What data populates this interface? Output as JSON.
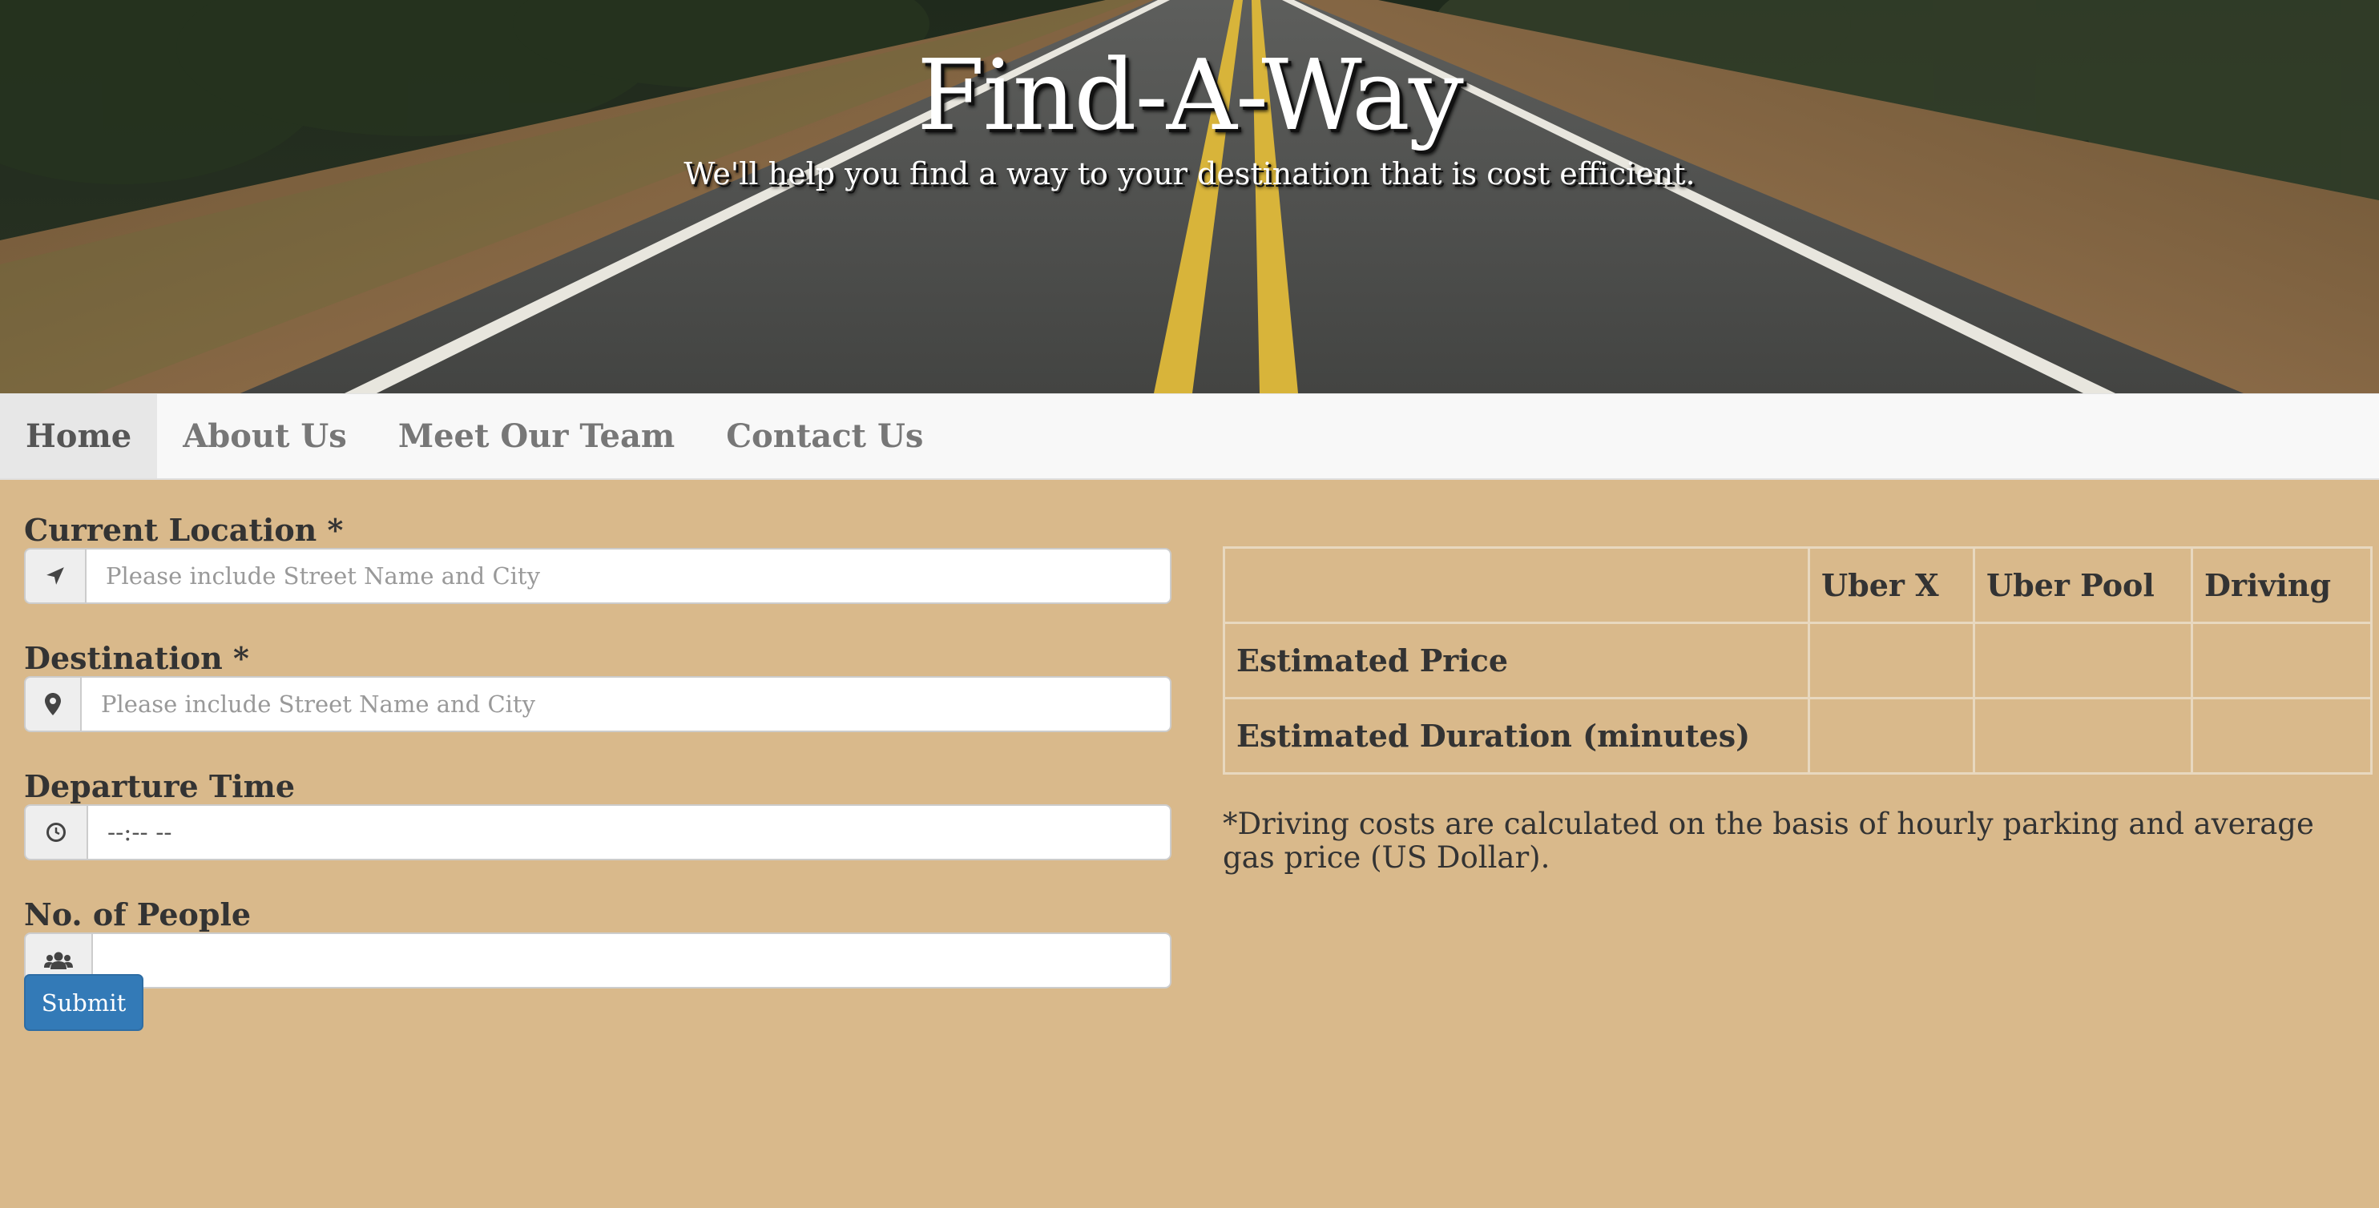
{
  "hero": {
    "title": "Find-A-Way",
    "subtitle": "We'll help you find a way to your destination that is cost efficient."
  },
  "nav": {
    "items": [
      {
        "label": "Home",
        "active": true
      },
      {
        "label": "About Us",
        "active": false
      },
      {
        "label": "Meet Our Team",
        "active": false
      },
      {
        "label": "Contact Us",
        "active": false
      }
    ]
  },
  "form": {
    "current_location": {
      "label": "Current Location *",
      "placeholder": "Please include Street Name and City",
      "value": "",
      "icon": "location-arrow-icon"
    },
    "destination": {
      "label": "Destination *",
      "placeholder": "Please include Street Name and City",
      "value": "",
      "icon": "map-marker-icon"
    },
    "departure_time": {
      "label": "Departure Time",
      "display": "--:-- --",
      "icon": "clock-icon"
    },
    "people": {
      "label": "No. of People",
      "value": "",
      "icon": "users-icon"
    },
    "submit_label": "Submit"
  },
  "results": {
    "headers": [
      "",
      "Uber X",
      "Uber Pool",
      "Driving"
    ],
    "rows": [
      {
        "label": "Estimated Price",
        "values": [
          "",
          "",
          ""
        ]
      },
      {
        "label": "Estimated Duration (minutes)",
        "values": [
          "",
          "",
          ""
        ]
      }
    ],
    "note": "*Driving costs are calculated on the basis of hourly parking and average gas price (US Dollar)."
  },
  "colors": {
    "page_background": "#d9b98b",
    "nav_background": "#f8f8f8",
    "submit_button": "#337ab7"
  }
}
